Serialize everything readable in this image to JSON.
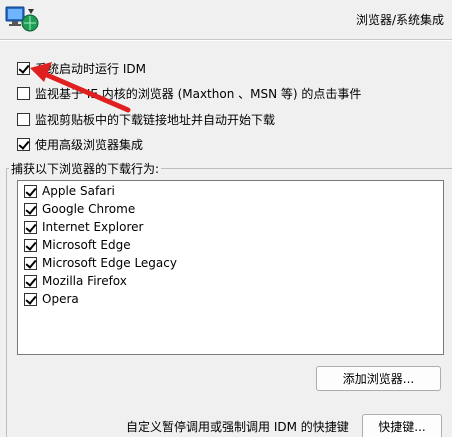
{
  "header": {
    "title": "浏览器/系统集成"
  },
  "options": [
    {
      "label": "系统启动时运行 IDM",
      "checked": true
    },
    {
      "label": "监视基于 IE 内核的浏览器 (Maxthon 、MSN 等) 的点击事件",
      "checked": false
    },
    {
      "label": "监视剪贴板中的下载链接地址并自动开始下载",
      "checked": false
    },
    {
      "label": "使用高级浏览器集成",
      "checked": true
    }
  ],
  "browsers_group": {
    "label": "捕获以下浏览器的下载行为:",
    "items": [
      {
        "label": "Apple Safari",
        "checked": true
      },
      {
        "label": "Google Chrome",
        "checked": true
      },
      {
        "label": "Internet Explorer",
        "checked": true
      },
      {
        "label": "Microsoft Edge",
        "checked": true
      },
      {
        "label": "Microsoft Edge Legacy",
        "checked": true
      },
      {
        "label": "Mozilla Firefox",
        "checked": true
      },
      {
        "label": "Opera",
        "checked": true
      }
    ],
    "add_button": "添加浏览器..."
  },
  "shortcut": {
    "label": "自定义暂停调用或强制调用 IDM 的快捷键",
    "button": "快捷键..."
  },
  "colors": {
    "arrow": "#e02020",
    "logo_blue": "#1a5fb4",
    "logo_green": "#2ea043"
  }
}
